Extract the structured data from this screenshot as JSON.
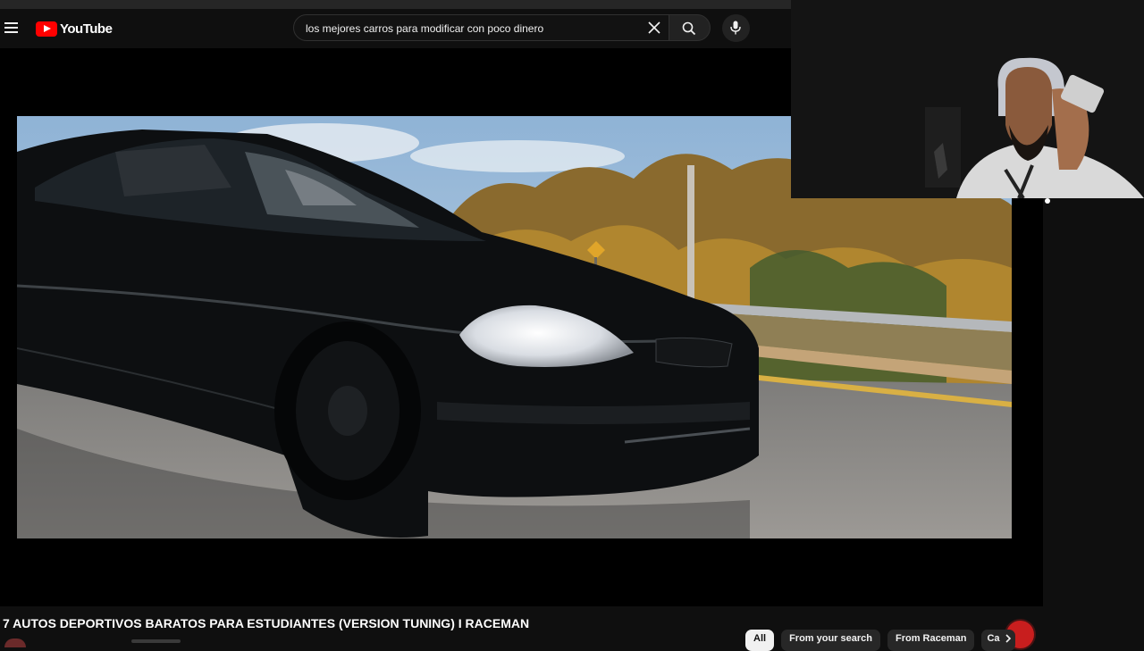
{
  "app": {
    "logo_text": "YouTube"
  },
  "header": {
    "search_value": "los mejores carros para modificar con poco dinero",
    "icons": [
      "menu-icon",
      "clear-icon",
      "search-icon",
      "mic-icon"
    ]
  },
  "video": {
    "title": "7 AUTOS DEPORTIVOS BARATOS PARA ESTUDIANTES (VERSION TUNING) I RACEMAN"
  },
  "related_chips": [
    "All",
    "From your search",
    "From Raceman",
    "Ca"
  ],
  "colors": {
    "brand": "#ff0000",
    "background": "#0f0f0f",
    "chip_bg": "#272727",
    "chip_active_bg": "#f1f1f1"
  }
}
